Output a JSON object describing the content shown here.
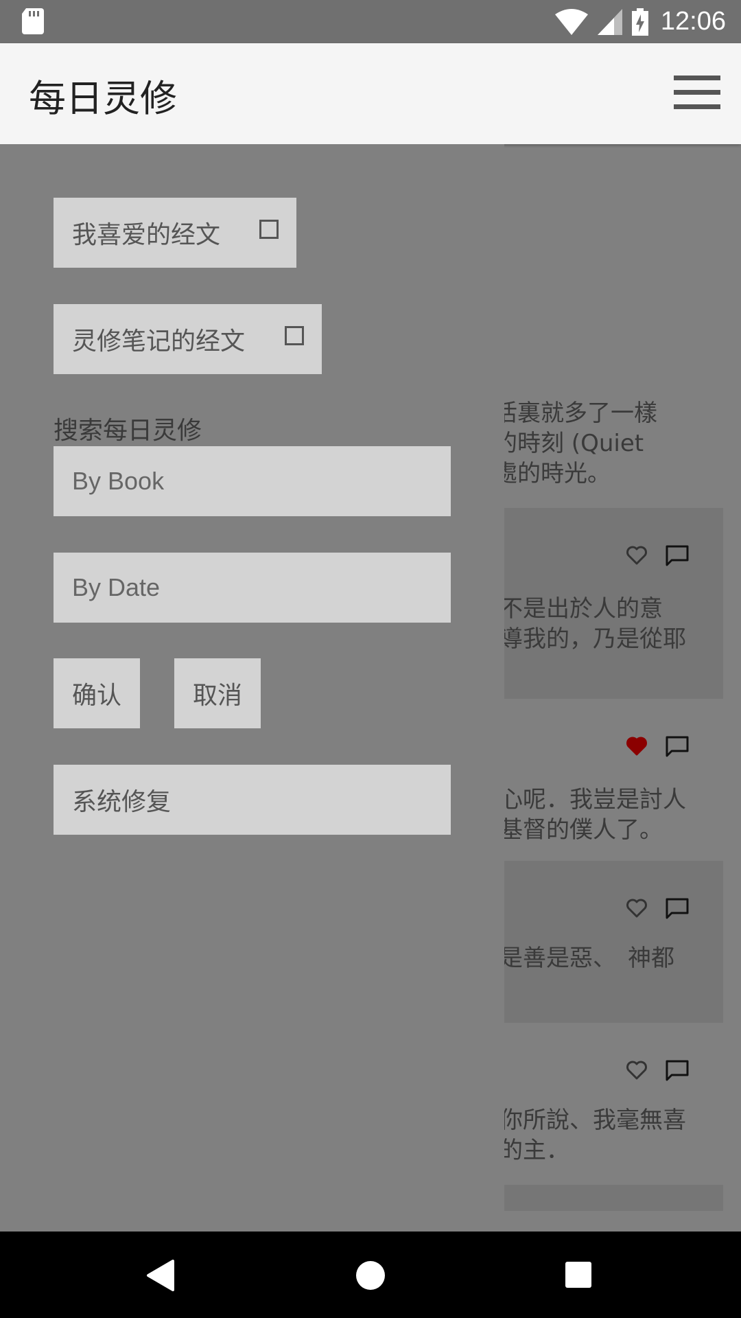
{
  "status_bar": {
    "time": "12:06",
    "icons": [
      "sd-card-icon",
      "wifi-icon",
      "cell-signal-icon",
      "battery-charging-icon"
    ]
  },
  "app_bar": {
    "title": "每日灵修",
    "menu_icon": "hamburger-menu-icon"
  },
  "drawer": {
    "favorites_label": "我喜爱的经文",
    "notes_label": "灵修笔记的经文",
    "search_title": "搜索每日灵修",
    "by_book_placeholder": "By Book",
    "by_date_placeholder": "By Date",
    "confirm_label": "确认",
    "cancel_label": "取消",
    "repair_label": "系统修复"
  },
  "background": {
    "intro_text": "活裏就多了一樣\n的時刻 (Quiet\n處的時光。",
    "cards": [
      {
        "text": "不是出於人的意\n導我的，乃是從耶",
        "liked": false
      },
      {
        "text": "心呢．我豈是討人\n基督的僕人了。",
        "liked": true
      },
      {
        "text": "是善是惡、　神都",
        "liked": false
      },
      {
        "text": "你所說、我毫無喜\n的主．",
        "liked": false
      }
    ]
  },
  "colors": {
    "liked_heart": "#8b0000",
    "app_bar_bg": "#f5f5f5",
    "drawer_bg": "#808080",
    "drawer_button_bg": "#d3d3d3"
  },
  "nav_bar": {
    "icons": [
      "back-icon",
      "home-icon",
      "recents-icon"
    ]
  }
}
